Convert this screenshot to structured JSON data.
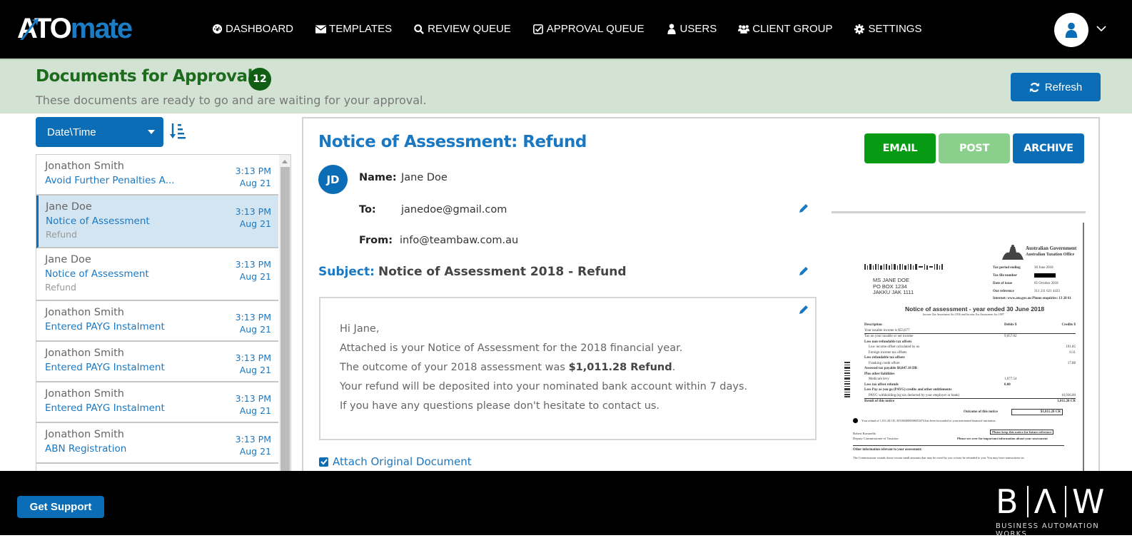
{
  "app": {
    "logo_part1": "ATO",
    "logo_part2": "mate",
    "brand_color": "#1b7cc4"
  },
  "nav": {
    "items": [
      {
        "label": "DASHBOARD",
        "icon": "dashboard-icon"
      },
      {
        "label": "TEMPLATES",
        "icon": "envelope-icon"
      },
      {
        "label": "REVIEW QUEUE",
        "icon": "search-icon"
      },
      {
        "label": "APPROVAL QUEUE",
        "icon": "check-square-icon"
      },
      {
        "label": "USERS",
        "icon": "user-icon"
      },
      {
        "label": "CLIENT GROUP",
        "icon": "users-icon"
      },
      {
        "label": "SETTINGS",
        "icon": "gear-icon"
      }
    ],
    "user_menu_icon": "user-avatar-icon"
  },
  "header": {
    "title": "Documents for Approval",
    "count": "12",
    "subtitle": "These documents are ready to go and are waiting for your approval.",
    "refresh_label": "Refresh"
  },
  "sort": {
    "selected": "Date\\Time"
  },
  "documents": [
    {
      "name": "Jonathon Smith",
      "subject": "Avoid Further Penalties A...",
      "extra": "",
      "time": "3:13 PM",
      "date": "Aug 21",
      "selected": false
    },
    {
      "name": "Jane Doe",
      "subject": "Notice of Assessment",
      "extra": "Refund",
      "time": "3:13 PM",
      "date": "Aug 21",
      "selected": true
    },
    {
      "name": "Jane Doe",
      "subject": "Notice of Assessment",
      "extra": "Refund",
      "time": "3:13 PM",
      "date": "Aug 21",
      "selected": false
    },
    {
      "name": "Jonathon Smith",
      "subject": "Entered PAYG Instalment",
      "extra": "",
      "time": "3:13 PM",
      "date": "Aug 21",
      "selected": false
    },
    {
      "name": "Jonathon Smith",
      "subject": "Entered PAYG Instalment",
      "extra": "",
      "time": "3:13 PM",
      "date": "Aug 21",
      "selected": false
    },
    {
      "name": "Jonathon Smith",
      "subject": "Entered PAYG Instalment",
      "extra": "",
      "time": "3:13 PM",
      "date": "Aug 21",
      "selected": false
    },
    {
      "name": "Jonathon Smith",
      "subject": "ABN Registration",
      "extra": "",
      "time": "3:13 PM",
      "date": "Aug 21",
      "selected": false
    }
  ],
  "detail": {
    "title": "Notice of Assessment: Refund",
    "avatar_initials": "JD",
    "name_label": "Name:",
    "name_value": "Jane Doe",
    "to_label": "To:",
    "to_value": "janedoe@gmail.com",
    "from_label": "From:",
    "from_value": "info@teambaw.com.au",
    "subject_label": "Subject:",
    "subject_value": "Notice of Assessment 2018 - Refund",
    "actions": {
      "email": "EMAIL",
      "post": "POST",
      "archive": "ARCHIVE"
    },
    "body": {
      "greeting": "Hi Jane,",
      "line1": "Attached is your Notice of Assessment for the 2018 financial year.",
      "line2_prefix": "The outcome of your 2018 assessment was ",
      "line2_bold": "$1,011.28 Refund",
      "line2_suffix": ".",
      "line3": "Your refund will be deposited into your nominated bank account within 7 days.",
      "line4": "If you have any questions please don't hesitate to contact us."
    },
    "attach_label": "Attach Original Document",
    "attach_checked": true
  },
  "preview": {
    "gov_line1": "Australian Government",
    "gov_line2": "Australian Taxation Office",
    "address": [
      "MS JANE DOE",
      "PO BOX 1234",
      "JAKKU JAK 1111"
    ],
    "meta": [
      {
        "k": "Tax period ending",
        "v": "30 June 2018"
      },
      {
        "k": "Tax file number",
        "v": ""
      },
      {
        "k": "Date of issue",
        "v": "05 October 2018"
      },
      {
        "k": "Our reference",
        "v": "311 211 621 4433"
      }
    ],
    "contact": "Internet: www.ato.gov.au  Phone enquiries: 13 28 61",
    "heading": "Notice of assessment - year ended 30 June 2018",
    "subheading": "Income Tax Assessment Act 1936 and Income Tax Assessment Act 1997",
    "col_desc": "Description",
    "col_debits": "Debits $",
    "col_credits": "Credits $",
    "rows": [
      {
        "d": "Your taxable income is $53,677",
        "db": "",
        "cr": ""
      },
      {
        "d": "Tax on your taxable or net income",
        "db": "9,057.02",
        "cr": ""
      },
      {
        "d": "Less non-refundable tax offsets",
        "db": "",
        "cr": ""
      },
      {
        "d": "Low income offset calculated by us",
        "db": "",
        "cr": "191.85"
      },
      {
        "d": "Foreign income tax offsets",
        "db": "",
        "cr": "0.11"
      },
      {
        "d": "Less refundable tax offsets",
        "db": "",
        "cr": ""
      },
      {
        "d": "Franking credit offset",
        "db": "",
        "cr": "17.88"
      },
      {
        "d": "Assessed tax payable $8,847.18 DR",
        "db": "",
        "cr": ""
      },
      {
        "d": "Plus other liabilities",
        "db": "",
        "cr": ""
      },
      {
        "d": "Medicare levy",
        "db": "1,077.54",
        "cr": ""
      },
      {
        "d": "Less tax offset refunds",
        "db": "0.00",
        "cr": ""
      },
      {
        "d": "Less Pay as you go (PAYG) credits and other entitlements",
        "db": "",
        "cr": ""
      },
      {
        "d": "PAYG withholding (eg tax deducted by your employer or bank)",
        "db": "",
        "cr": "10,936.00"
      },
      {
        "d": "Result of this notice",
        "db": "",
        "cr": "1,011.28 CR"
      }
    ],
    "outcome_label": "Outcome of this notice",
    "outcome_value": "$1,011.28 CR",
    "refund_note": "Your refund of 1,011.28 CR, ATO004000006653474 has been forwarded to your nominated financial institution.",
    "signatory": "Robert Ravanello",
    "signatory_title": "Deputy Commissioner of Taxation",
    "keep_notice": "Please keep this notice for future reference",
    "see_over": "Please see over for important information about your assessment",
    "other_info": "Other information relevant to your assessment:",
    "other_text": "The Commissioner rounds down certain small amounts that may be owed by you or may be refunded to you. You may have transactions on"
  },
  "footer": {
    "support_label": "Get Support",
    "baw_b": "B",
    "baw_a": "Λ",
    "baw_w": "W",
    "baw_tagline": "BUSINESS AUTOMATION WORKS"
  }
}
